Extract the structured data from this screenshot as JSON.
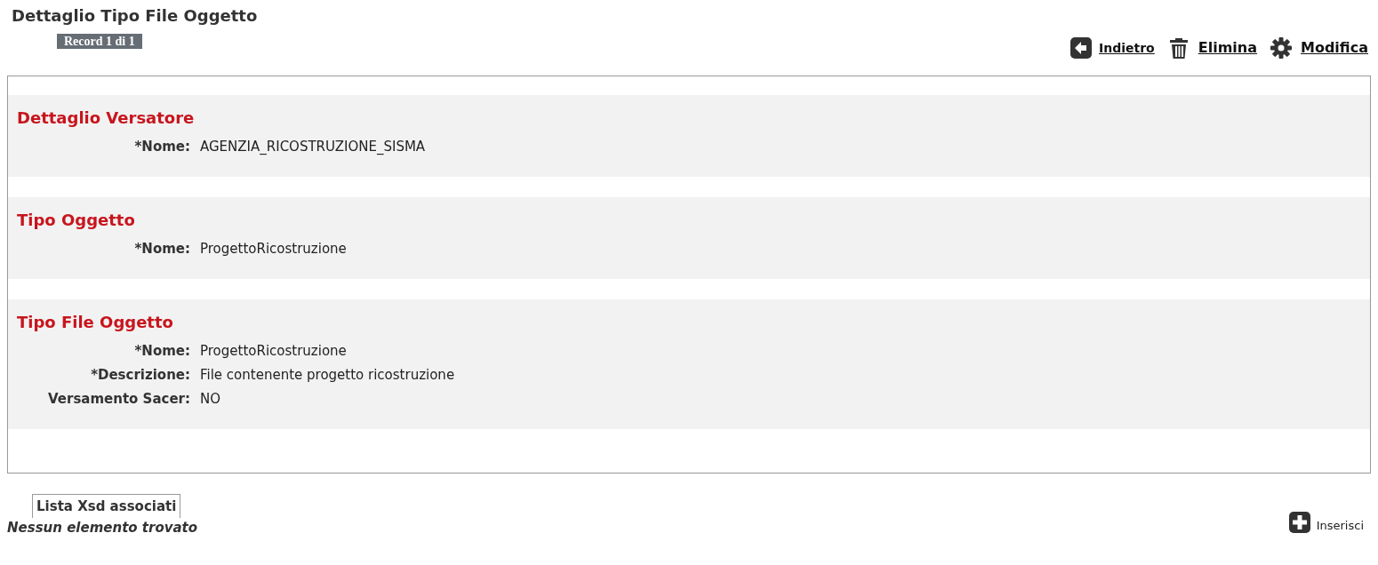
{
  "title": "Dettaglio Tipo File Oggetto",
  "record_badge": "Record 1 di 1",
  "actions": [
    {
      "kind": "back",
      "label": "Indietro"
    },
    {
      "kind": "delete",
      "label": "Elimina"
    },
    {
      "kind": "edit",
      "label": "Modifica"
    }
  ],
  "sections": [
    {
      "title": "Dettaglio Versatore",
      "fields": [
        {
          "label": "*Nome:",
          "value": "AGENZIA_RICOSTRUZIONE_SISMA"
        }
      ]
    },
    {
      "title": "Tipo Oggetto",
      "fields": [
        {
          "label": "*Nome:",
          "value": "ProgettoRicostruzione"
        }
      ]
    },
    {
      "title": "Tipo File Oggetto",
      "fields": [
        {
          "label": "*Nome:",
          "value": "ProgettoRicostruzione"
        },
        {
          "label": "*Descrizione:",
          "value": "File contenente progetto ricostruzione"
        },
        {
          "label": "Versamento Sacer:",
          "value": "NO"
        }
      ]
    }
  ],
  "list_tab": "Lista Xsd associati",
  "empty_message": "Nessun elemento trovato",
  "insert_button": "Inserisci"
}
